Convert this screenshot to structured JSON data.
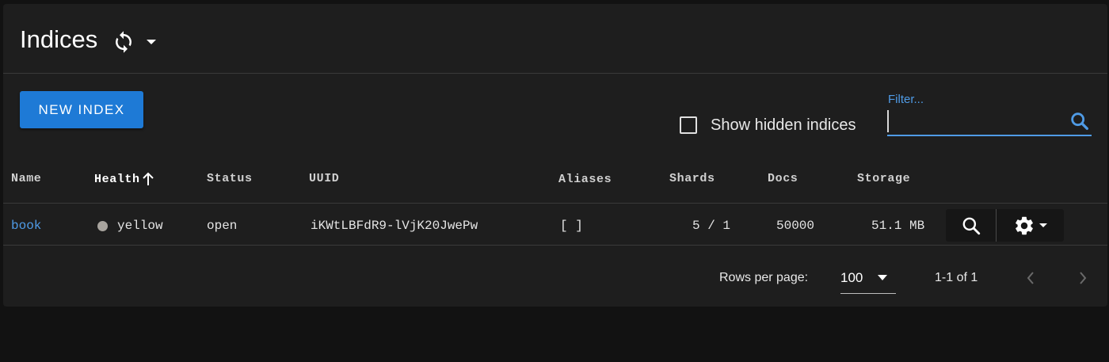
{
  "header": {
    "title": "Indices",
    "refresh_icon": "refresh-icon",
    "menu_icon": "caret-down-icon"
  },
  "toolbar": {
    "new_index_label": "NEW INDEX",
    "show_hidden_label": "Show hidden indices",
    "show_hidden_checked": false,
    "filter_label": "Filter...",
    "filter_value": "",
    "accent_color": "#1e7ad6"
  },
  "table": {
    "columns": {
      "name": "Name",
      "health": "Health",
      "status": "Status",
      "uuid": "UUID",
      "aliases": "Aliases",
      "shards": "Shards",
      "docs": "Docs",
      "storage": "Storage"
    },
    "sorted_by": "Health",
    "rows": [
      {
        "name": "book",
        "health": "yellow",
        "health_color": "#a8a49e",
        "status": "open",
        "uuid": "iKWtLBFdR9-lVjK20JwePw",
        "aliases": "[ ]",
        "shards": "5 / 1",
        "docs": "50000",
        "storage": "51.1 MB"
      }
    ]
  },
  "pagination": {
    "rows_per_page_label": "Rows per page:",
    "rows_per_page_value": "100",
    "range_text": "1-1 of 1"
  }
}
